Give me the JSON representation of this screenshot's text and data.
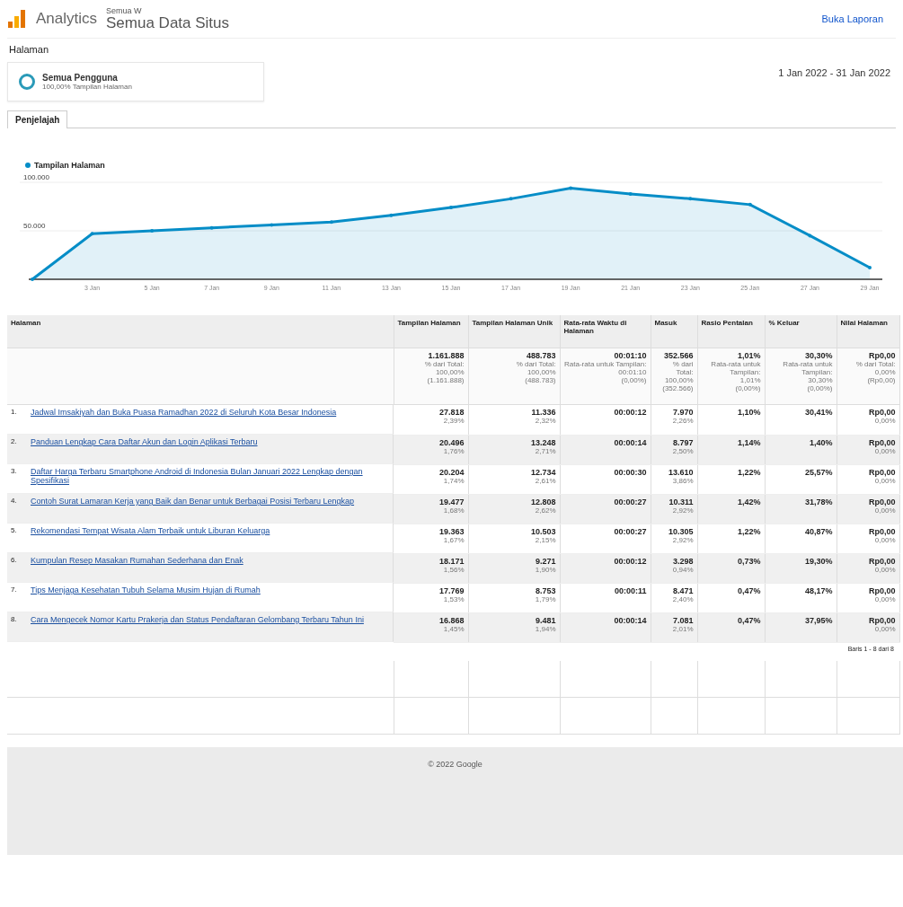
{
  "header": {
    "product": "Analytics",
    "account": "Semua W",
    "view": "Semua Data Situs",
    "action": "Buka Laporan"
  },
  "page_title": "Halaman",
  "segment": {
    "name": "Semua Pengguna",
    "detail": "100,00% Tampilan Halaman"
  },
  "date_range": "1 Jan 2022 - 31 Jan 2022",
  "tabs": [
    {
      "label": "Penjelajah",
      "selected": true
    }
  ],
  "chart": {
    "chart_data": {
      "type": "area",
      "categories": [
        null,
        "3 Jan",
        "5 Jan",
        "7 Jan",
        "9 Jan",
        "11 Jan",
        "13 Jan",
        "15 Jan",
        "17 Jan",
        "19 Jan",
        "21 Jan",
        "23 Jan",
        "25 Jan",
        "27 Jan",
        "29 Jan"
      ],
      "series": [
        {
          "name": "Tampilan Halaman",
          "color": "#058dc7",
          "values": [
            0,
            47000,
            50000,
            53000,
            56000,
            59000,
            66000,
            74000,
            83000,
            94000,
            88000,
            83000,
            77000,
            45000,
            12000
          ]
        }
      ],
      "ylim": [
        0,
        100000
      ],
      "yticks": [
        {
          "value": 50000,
          "label": "50.000"
        },
        {
          "value": 100000,
          "label": "100.000"
        }
      ]
    }
  },
  "table": {
    "columns": [
      "Halaman",
      "Tampilan Halaman",
      "Tampilan Halaman Unik",
      "Rata-rata Waktu di Halaman",
      "Masuk",
      "Rasio Pentalan",
      "% Keluar",
      "Nilai Halaman"
    ],
    "totals": [
      [
        "1.161.888",
        "% dari Total:",
        "100,00%",
        "(1.161.888)"
      ],
      [
        "488.783",
        "% dari Total:",
        "100,00%",
        "(488.783)"
      ],
      [
        "00:01:10",
        "Rata-rata untuk Tampilan:",
        "00:01:10",
        "(0,00%)"
      ],
      [
        "352.566",
        "% dari Total:",
        "100,00%",
        "(352.566)"
      ],
      [
        "1,01%",
        "Rata-rata untuk Tampilan:",
        "1,01%",
        "(0,00%)"
      ],
      [
        "30,30%",
        "Rata-rata untuk Tampilan:",
        "30,30%",
        "(0,00%)"
      ],
      [
        "Rp0,00",
        "% dari Total:",
        "0,00%",
        "(Rp0,00)"
      ]
    ],
    "rows": [
      {
        "cells": [
          [
            "1.",
            "Jadwal Imsakiyah dan Buka Puasa Ramadhan 2022 di Seluruh Kota Besar Indonesia"
          ],
          [
            "27.818",
            "2,39%"
          ],
          [
            "11.336",
            "2,32%"
          ],
          [
            "00:00:12",
            ""
          ],
          [
            "7.970",
            "2,26%"
          ],
          [
            "1,10%",
            ""
          ],
          [
            "30,41%",
            ""
          ],
          [
            "Rp0,00",
            "0,00%"
          ]
        ]
      },
      {
        "cells": [
          [
            "2.",
            "Panduan Lengkap Cara Daftar Akun dan Login Aplikasi Terbaru"
          ],
          [
            "20.496",
            "1,76%"
          ],
          [
            "13.248",
            "2,71%"
          ],
          [
            "00:00:14",
            ""
          ],
          [
            "8.797",
            "2,50%"
          ],
          [
            "1,14%",
            ""
          ],
          [
            "1,40%",
            ""
          ],
          [
            "Rp0,00",
            "0,00%"
          ]
        ]
      },
      {
        "cells": [
          [
            "3.",
            "Daftar Harga Terbaru Smartphone Android di Indonesia Bulan Januari 2022 Lengkap dengan Spesifikasi"
          ],
          [
            "20.204",
            "1,74%"
          ],
          [
            "12.734",
            "2,61%"
          ],
          [
            "00:00:30",
            ""
          ],
          [
            "13.610",
            "3,86%"
          ],
          [
            "1,22%",
            ""
          ],
          [
            "25,57%",
            ""
          ],
          [
            "Rp0,00",
            "0,00%"
          ]
        ]
      },
      {
        "cells": [
          [
            "4.",
            "Contoh Surat Lamaran Kerja yang Baik dan Benar untuk Berbagai Posisi Terbaru Lengkap"
          ],
          [
            "19.477",
            "1,68%"
          ],
          [
            "12.808",
            "2,62%"
          ],
          [
            "00:00:27",
            ""
          ],
          [
            "10.311",
            "2,92%"
          ],
          [
            "1,42%",
            ""
          ],
          [
            "31,78%",
            ""
          ],
          [
            "Rp0,00",
            "0,00%"
          ]
        ]
      },
      {
        "cells": [
          [
            "5.",
            "Rekomendasi Tempat Wisata Alam Terbaik untuk Liburan Keluarga"
          ],
          [
            "19.363",
            "1,67%"
          ],
          [
            "10.503",
            "2,15%"
          ],
          [
            "00:00:27",
            ""
          ],
          [
            "10.305",
            "2,92%"
          ],
          [
            "1,22%",
            ""
          ],
          [
            "40,87%",
            ""
          ],
          [
            "Rp0,00",
            "0,00%"
          ]
        ]
      },
      {
        "cells": [
          [
            "6.",
            "Kumpulan Resep Masakan Rumahan Sederhana dan Enak"
          ],
          [
            "18.171",
            "1,56%"
          ],
          [
            "9.271",
            "1,90%"
          ],
          [
            "00:00:12",
            ""
          ],
          [
            "3.298",
            "0,94%"
          ],
          [
            "0,73%",
            ""
          ],
          [
            "19,30%",
            ""
          ],
          [
            "Rp0,00",
            "0,00%"
          ]
        ]
      },
      {
        "cells": [
          [
            "7.",
            "Tips Menjaga Kesehatan Tubuh Selama Musim Hujan di Rumah"
          ],
          [
            "17.769",
            "1,53%"
          ],
          [
            "8.753",
            "1,79%"
          ],
          [
            "00:00:11",
            ""
          ],
          [
            "8.471",
            "2,40%"
          ],
          [
            "0,47%",
            ""
          ],
          [
            "48,17%",
            ""
          ],
          [
            "Rp0,00",
            "0,00%"
          ]
        ]
      },
      {
        "cells": [
          [
            "8.",
            "Cara Mengecek Nomor Kartu Prakerja dan Status Pendaftaran Gelombang Terbaru Tahun Ini"
          ],
          [
            "16.868",
            "1,45%"
          ],
          [
            "9.481",
            "1,94%"
          ],
          [
            "00:00:14",
            ""
          ],
          [
            "7.081",
            "2,01%"
          ],
          [
            "0,47%",
            ""
          ],
          [
            "37,95%",
            ""
          ],
          [
            "Rp0,00",
            "0,00%"
          ]
        ]
      }
    ],
    "rows_info": "Baris 1 - 8 dari 8"
  },
  "footer": "© 2022 Google"
}
